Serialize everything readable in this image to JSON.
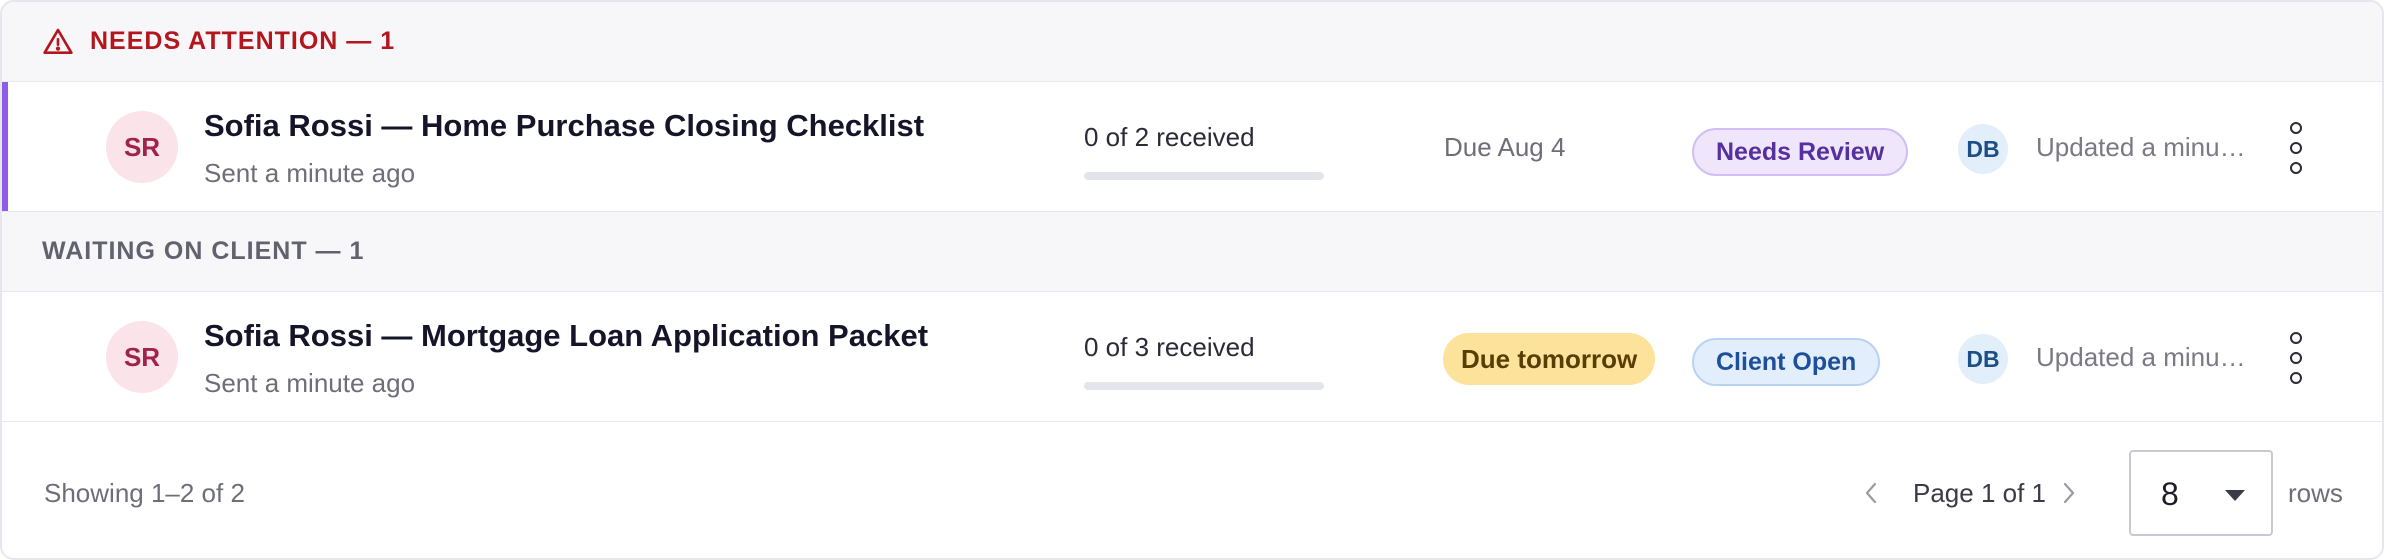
{
  "groups": [
    {
      "label": "NEEDS ATTENTION — 1",
      "tone": "#b3161d",
      "rows": [
        {
          "initials": "SR",
          "title": "Sofia Rossi — Home Purchase Closing Checklist",
          "subtitle": "Sent a minute ago",
          "progress_text": "0 of 2 received",
          "progress": 0,
          "due": "Due Aug 4",
          "status": "Needs Review",
          "assignee": "DB",
          "updated": "Updated a minute ago"
        }
      ]
    },
    {
      "label": "WAITING ON CLIENT — 1",
      "tone": "#62626e",
      "rows": [
        {
          "initials": "SR",
          "title": "Sofia Rossi — Mortgage Loan Application Packet",
          "subtitle": "Sent a minute ago",
          "progress_text": "0 of 3 received",
          "progress": 0,
          "due": "Due tomorrow",
          "status": "Client Open",
          "assignee": "DB",
          "updated": "Updated a minute ago"
        }
      ]
    }
  ],
  "footer": {
    "showing": "Showing 1–2 of 2",
    "page": "Page 1 of 1",
    "rows_per_page": "8",
    "rows_label": "rows"
  },
  "colors": {
    "accent": "#8e5ce6",
    "needs_review": "#55309e",
    "client_open": "#1d4f9b",
    "due_soon": "#fde29b"
  },
  "icons": {
    "attention": "warning-triangle-icon",
    "more": "more-vertical-icon",
    "prev": "chevron-left-icon",
    "next": "chevron-right-icon",
    "select": "caret-down-icon"
  }
}
